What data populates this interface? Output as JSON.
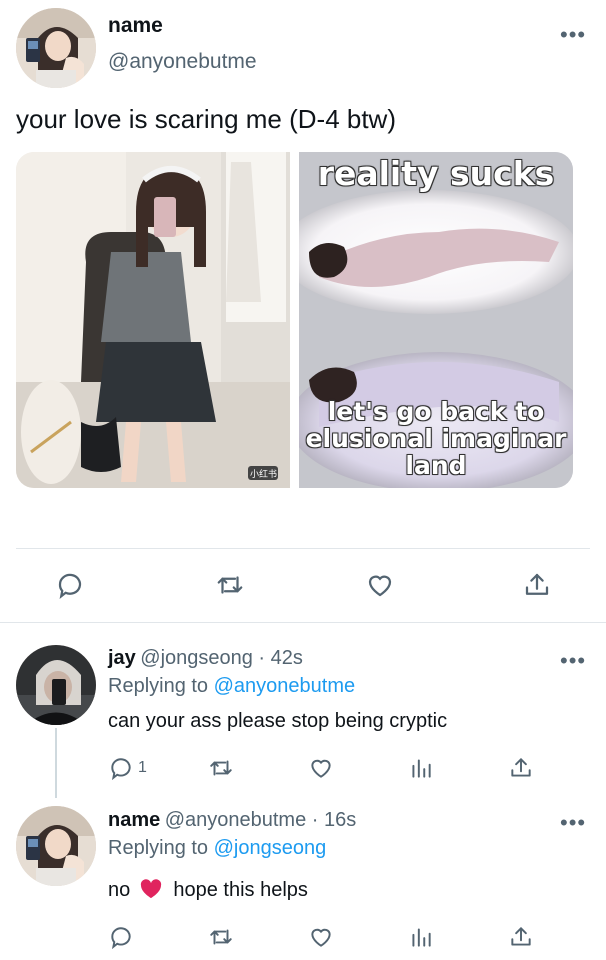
{
  "tweet": {
    "name": "name",
    "handle": "@anyonebutme",
    "more": "•••",
    "text": "your love is scaring me (D-4 btw)",
    "media": {
      "left_image": {
        "watermark": "小红书"
      },
      "right_image": {
        "top_text": "reality sucks",
        "bottom_line1": "let's go back to",
        "bottom_line2": "elusional imaginar",
        "bottom_line3": "land"
      }
    },
    "actions": [
      "reply-icon",
      "retweet-icon",
      "like-icon",
      "share-icon"
    ]
  },
  "replies": [
    {
      "name": "jay",
      "handle_time": "@jongseong · 42s",
      "replying_prefix": "Replying to ",
      "replying_to": "@anyonebutme",
      "text": "can your ass please stop being cryptic",
      "reply_count": "1",
      "more": "•••"
    },
    {
      "name": "name",
      "handle_time": "@anyonebutme · 16s",
      "replying_prefix": "Replying to ",
      "replying_to": "@jongseong",
      "text_before": "no",
      "emoji": "❤️",
      "text_after": "hope this helps",
      "more": "•••"
    }
  ],
  "colors": {
    "link": "#1d9bf0",
    "secondary": "#536471",
    "heart": "#e0245e"
  }
}
